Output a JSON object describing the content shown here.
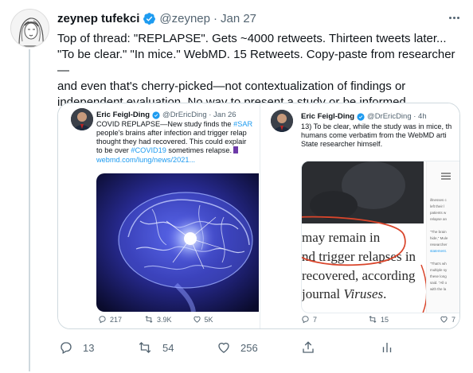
{
  "tweet": {
    "author_name": "zeynep tufekci",
    "handle": "@zeynep",
    "separator": "·",
    "time": "Jan 27",
    "text_lines": [
      "Top of thread: \"REPLAPSE\". Gets ~4000 retweets. Thirteen tweets later...",
      "\"To be clear.\" \"In mice.\" WebMD. 15 Retweets. Copy-paste from researcher—",
      "and even that's cherry-picked—not contextualization of findings or",
      "independent evaluation. No way to present a study or be informed."
    ],
    "actions": {
      "replies": "13",
      "retweets": "54",
      "likes": "256"
    }
  },
  "embed_left": {
    "name": "Eric Feigl-Ding",
    "meta": "@DrEricDing · Jan 26",
    "text": {
      "l1_pre": "COVID REPLAPSE—New study finds the ",
      "l1_tag": "#SAR",
      "l2": "people's brains after infection and trigger relap",
      "l3": "thought they had recovered. This could explair",
      "l4_pre": "to be over ",
      "l4_tag": "#COVID19",
      "l4_post": " sometimes relapse.",
      "l5": "webmd.com/lung/news/2021..."
    },
    "actions": {
      "replies": "217",
      "retweets": "3.9K",
      "likes": "5K"
    }
  },
  "embed_right": {
    "name": "Eric Feigl-Ding",
    "meta": "@DrEricDing · 4h",
    "text": {
      "l1": "13) To be clear, while the study was in mice, th",
      "l2": "humans come verbatim from the WebMD arti",
      "l3": "State researcher himself."
    },
    "article_lines": {
      "l1": "may remain in",
      "l2": "nd trigger relapses in",
      "l3": "recovered, according",
      "l4_pre": "journal ",
      "l4_em": "Viruses",
      "l4_post": "."
    },
    "side_lines": [
      "illnesses c",
      "left their l",
      "patients w",
      "relapse an",
      "\"The brain",
      "hide,\" Mule",
      "researcher",
      "statement.",
      "\"That's wh",
      "multiple sy",
      "these long",
      "said. \"All o",
      "with the la"
    ],
    "actions": {
      "replies": "7",
      "retweets": "15",
      "likes": "7"
    }
  },
  "colors": {
    "accent": "#1d9bf0",
    "secondary_text": "#536471",
    "annotation_red": "#d9452b"
  },
  "icons": [
    "more-icon",
    "verified-icon",
    "reply-icon",
    "retweet-icon",
    "like-icon",
    "share-icon",
    "analytics-icon"
  ]
}
